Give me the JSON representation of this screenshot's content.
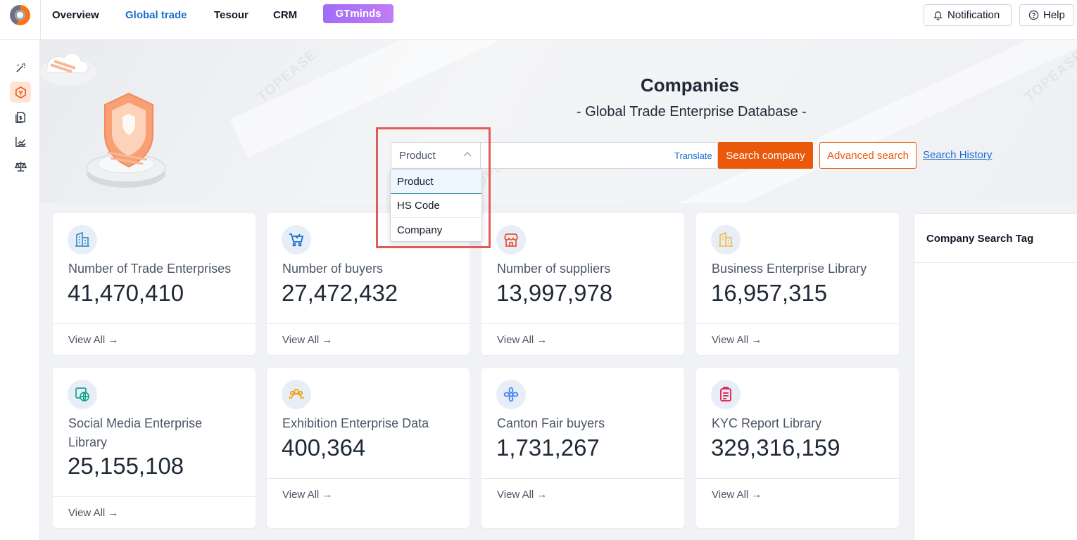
{
  "nav": {
    "items": [
      "Overview",
      "Global trade",
      "Tesour",
      "CRM"
    ],
    "gtminds": "GTminds",
    "notification": "Notification",
    "help": "Help"
  },
  "hero": {
    "title": "Companies",
    "subtitle": "- Global Trade Enterprise Database -",
    "watermark": "TOPEASE"
  },
  "search": {
    "select_value": "Product",
    "translate": "Translate",
    "search_button": "Search company",
    "advanced_button": "Advanced search",
    "history_link": "Search History",
    "options": [
      "Product",
      "HS Code",
      "Company"
    ]
  },
  "cards": [
    {
      "label": "Number of Trade Enterprises",
      "value": "41,470,410",
      "foot": "View All →",
      "icon": "building-icon",
      "color": "#3b8fc9"
    },
    {
      "label": "Number of buyers",
      "value": "27,472,432",
      "foot": "View All →",
      "icon": "cart-icon",
      "color": "#1a6fd0"
    },
    {
      "label": "Number of suppliers",
      "value": "13,997,978",
      "foot": "View All →",
      "icon": "store-icon",
      "color": "#e8552a"
    },
    {
      "label": "Business Enterprise Library",
      "value": "16,957,315",
      "foot": "View All →",
      "icon": "office-icon",
      "color": "#f2c14e"
    },
    {
      "label": "Social Media Enterprise Library",
      "value": "25,155,108",
      "foot": "View All →",
      "icon": "globe-icon",
      "color": "#0fa58a"
    },
    {
      "label": "Exhibition Enterprise Data",
      "value": "400,364",
      "foot": "View All →",
      "icon": "group-icon",
      "color": "#f59e0b"
    },
    {
      "label": "Canton Fair buyers",
      "value": "1,731,267",
      "foot": "View All →",
      "icon": "flower-icon",
      "color": "#3b82f6"
    },
    {
      "label": "KYC Report Library",
      "value": "329,316,159",
      "foot": "View All →",
      "icon": "clipboard-icon",
      "color": "#e11d48"
    }
  ],
  "tag_panel": {
    "title": "Company Search Tag"
  }
}
